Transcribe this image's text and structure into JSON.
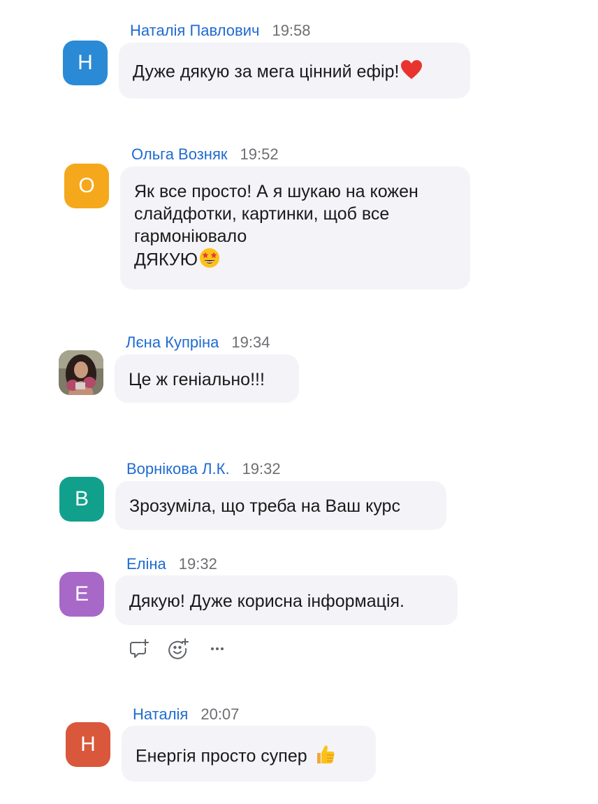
{
  "messages": [
    {
      "sender": "Наталія Павлович",
      "time": "19:58",
      "initial": "H",
      "avatar_color": "#2a8ad5",
      "lines": [
        "Дуже дякую за мега цінний ефір!"
      ],
      "emoji": "heart-emoji"
    },
    {
      "sender": "Ольга Возняк",
      "time": "19:52",
      "initial": "O",
      "avatar_color": "#f5a81c",
      "lines": [
        "Як все просто! А я шукаю на кожен",
        "слайдфотки, картинки, щоб все",
        "гармоніювало",
        "ДЯКУЮ"
      ],
      "emoji": "star-struck-emoji"
    },
    {
      "sender": "Лєна Купріна",
      "time": "19:34",
      "initial": "",
      "avatar_type": "photo",
      "lines": [
        "Це ж геніально!!!"
      ]
    },
    {
      "sender": "Ворнікова Л.К.",
      "time": "19:32",
      "initial": "B",
      "avatar_color": "#11a08c",
      "lines": [
        "Зрозуміла, що треба на Ваш курс"
      ]
    },
    {
      "sender": "Еліна",
      "time": "19:32",
      "initial": "E",
      "avatar_color": "#a868c8",
      "lines": [
        "Дякую! Дуже корисна інформація."
      ]
    },
    {
      "sender": "Наталія",
      "time": "20:07",
      "initial": "H",
      "avatar_color": "#d9573a",
      "lines": [
        "Енергія просто супер"
      ],
      "emoji": "thumbs-up-emoji"
    }
  ],
  "actions": {
    "reply_icon": "reply-thread-icon",
    "react_icon": "add-reaction-icon",
    "more_icon": "more-options-icon"
  }
}
